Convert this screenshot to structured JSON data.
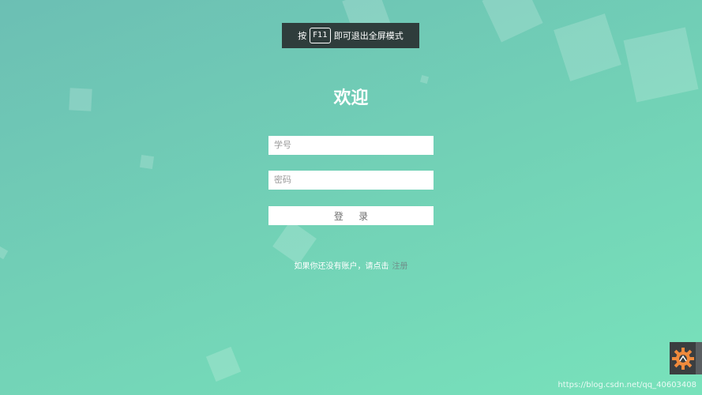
{
  "fullscreen_banner": {
    "prefix": "按",
    "key": "F11",
    "suffix": "即可退出全屏模式"
  },
  "login": {
    "title": "欢迎",
    "username_placeholder": "学号",
    "password_placeholder": "密码",
    "username_value": "",
    "password_value": "",
    "submit_label": "登 录"
  },
  "register": {
    "prompt": "如果你还没有账户，请点击",
    "link_label": "注册"
  },
  "watermark": "https://blog.csdn.net/qq_40603408",
  "colors": {
    "background_start": "#6cbfb4",
    "background_end": "#78e2bb",
    "banner_bg": "#2f3d3c",
    "register_link": "#6f8f8a"
  },
  "icons": {
    "floating_widget": "gear-icon"
  }
}
